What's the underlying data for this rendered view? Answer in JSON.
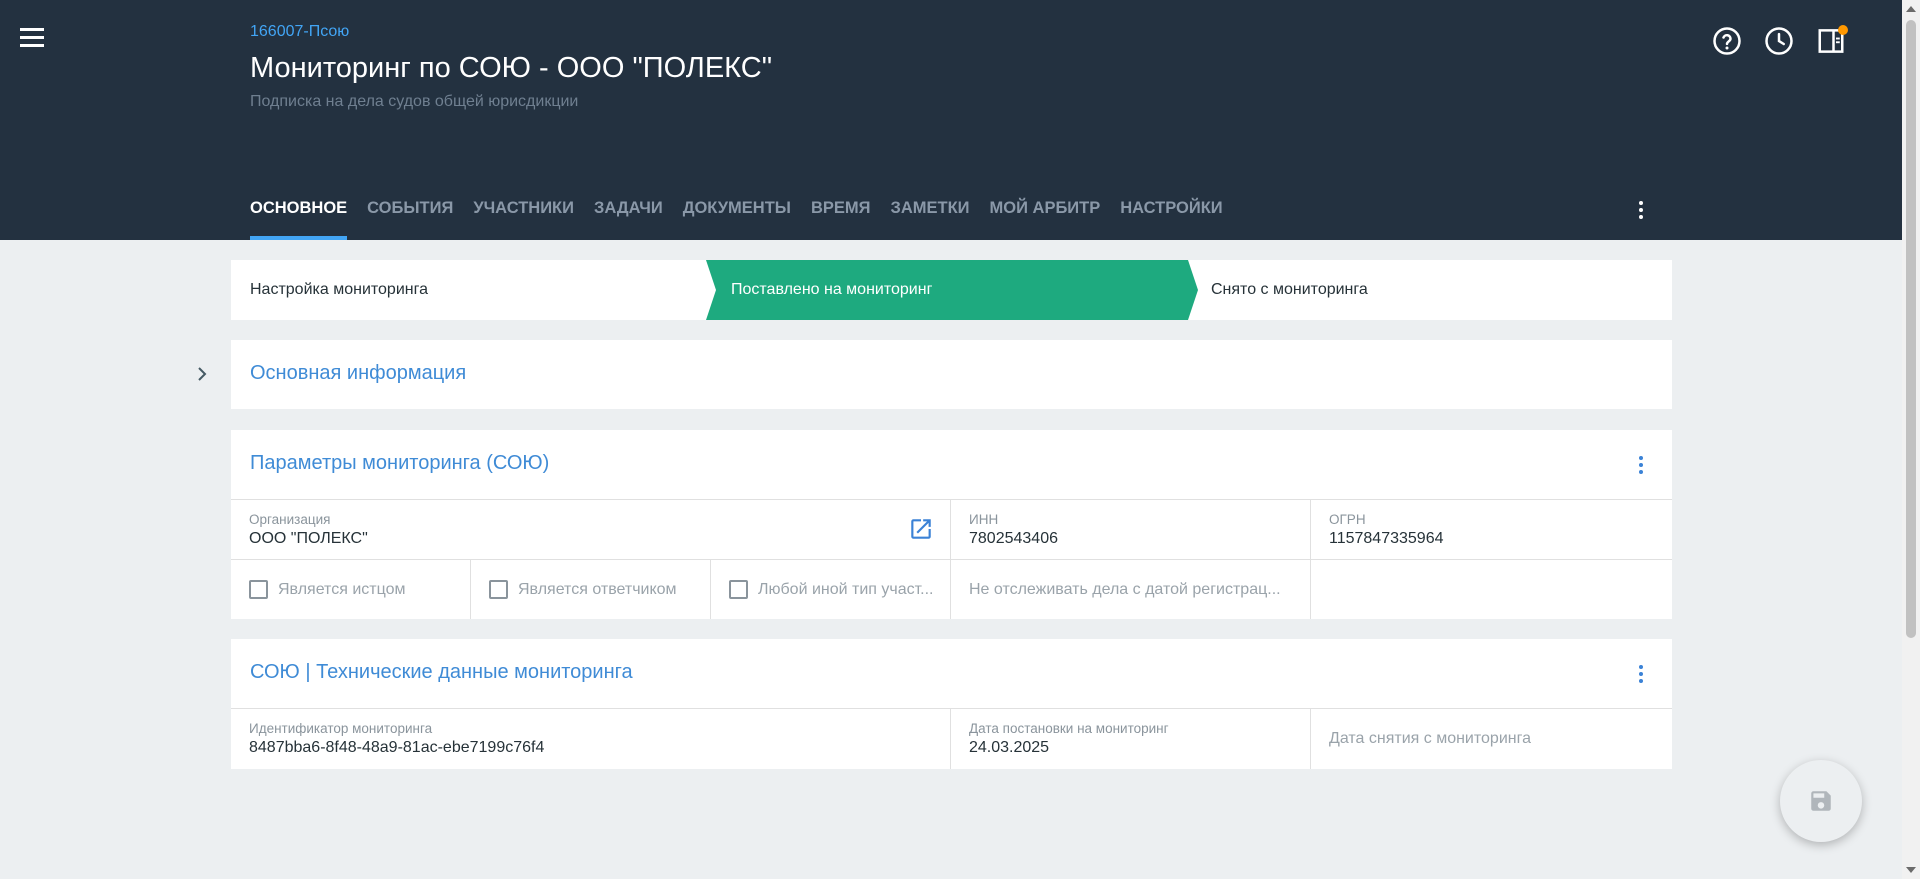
{
  "header": {
    "case_id": "166007-Псою",
    "title": "Мониторинг по СОЮ - ООО \"ПОЛЕКС\"",
    "subtitle": "Подписка на дела судов общей юрисдикции",
    "icons": [
      "help-icon",
      "history-icon",
      "side-panel-icon"
    ],
    "notification_color": "#ff9800"
  },
  "tabs": [
    {
      "label": "ОСНОВНОЕ",
      "active": true
    },
    {
      "label": "СОБЫТИЯ"
    },
    {
      "label": "УЧАСТНИКИ"
    },
    {
      "label": "ЗАДАЧИ"
    },
    {
      "label": "ДОКУМЕНТЫ"
    },
    {
      "label": "ВРЕМЯ"
    },
    {
      "label": "ЗАМЕТКИ"
    },
    {
      "label": "МОЙ АРБИТР"
    },
    {
      "label": "НАСТРОЙКИ"
    }
  ],
  "stepper": {
    "steps": [
      "Настройка мониторинга",
      "Поставлено на мониторинг",
      "Снято с мониторинга"
    ],
    "active_index": 1,
    "active_color": "#1eaa7f"
  },
  "main_info": {
    "title": "Основная информация"
  },
  "params": {
    "title": "Параметры мониторинга (СОЮ)",
    "organization_label": "Организация",
    "organization_value": "ООО \"ПОЛЕКС\"",
    "inn_label": "ИНН",
    "inn_value": "7802543406",
    "ogrn_label": "ОГРН",
    "ogrn_value": "1157847335964",
    "checkbox_plaintiff": "Является истцом",
    "checkbox_defendant": "Является ответчиком",
    "checkbox_other": "Любой иной тип участ...",
    "date_filter_placeholder": "Не отслеживать дела с датой регистрац..."
  },
  "tech": {
    "title": "СОЮ | Технические данные мониторинга",
    "id_label": "Идентификатор мониторинга",
    "id_value": "8487bba6-8f48-48a9-81ac-ebe7199c76f4",
    "start_label": "Дата постановки на мониторинг",
    "start_value": "24.03.2025",
    "end_placeholder": "Дата снятия с мониторинга"
  },
  "colors": {
    "header_bg": "#233140",
    "accent": "#42a5f5",
    "title_blue": "#3f8bd6"
  }
}
